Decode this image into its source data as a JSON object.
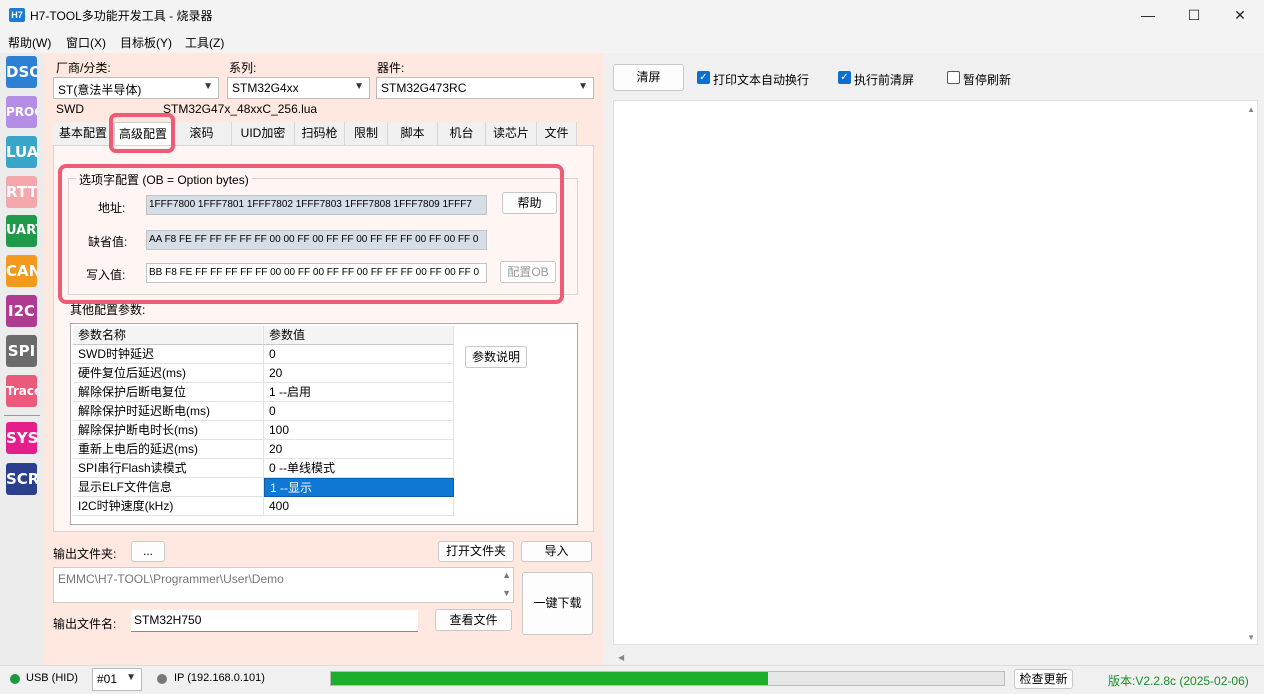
{
  "window": {
    "icon_text": "H7",
    "title": "H7-TOOL多功能开发工具 - 烧录器",
    "minimize": "—",
    "maximize": "☐",
    "close": "✕"
  },
  "menu": [
    "帮助(W)",
    "窗口(X)",
    "目标板(Y)",
    "工具(Z)"
  ],
  "toolbar": [
    {
      "label": "DSO",
      "color": "#2f7fd3"
    },
    {
      "label": "PROG",
      "color": "#b48ee6"
    },
    {
      "label": "LUA",
      "color": "#39a6c8"
    },
    {
      "label": "RTT",
      "color": "#f4a8ac"
    },
    {
      "label": "UART",
      "color": "#1f9a4a"
    },
    {
      "label": "CAN",
      "color": "#f39a1e"
    },
    {
      "label": "I2C",
      "color": "#b03a8f"
    },
    {
      "label": "SPI",
      "color": "#6b6b6b"
    },
    {
      "label": "Trace",
      "color": "#ea5a7a"
    },
    {
      "label": "SYS",
      "color": "#e41e8a"
    },
    {
      "label": "SCR",
      "color": "#2b3f8e"
    }
  ],
  "form": {
    "vendor_label": "厂商/分类:",
    "vendor_value": "ST(意法半导体)",
    "series_label": "系列:",
    "series_value": "STM32G4xx",
    "device_label": "器件:",
    "device_value": "STM32G473RC",
    "interface": "SWD",
    "lua_file": "STM32G47x_48xxC_256.lua"
  },
  "tabs": [
    "基本配置",
    "高级配置",
    "滚码",
    "UID加密",
    "扫码枪",
    "限制",
    "脚本",
    "机台",
    "读芯片",
    "文件"
  ],
  "active_tab": "高级配置",
  "option_bytes": {
    "group_title": "选项字配置 (OB = Option bytes)",
    "address_label": "地址:",
    "address_value": "1FFF7800 1FFF7801 1FFF7802 1FFF7803 1FFF7808 1FFF7809 1FFF7",
    "default_label": "缺省值:",
    "default_value": "AA F8 FE FF FF FF FF FF 00 00 FF 00 FF FF 00 FF FF FF 00 FF 00 FF 0",
    "write_label": "写入值:",
    "write_value": "BB F8 FE FF FF FF FF FF 00 00 FF 00 FF FF 00 FF FF FF 00 FF 00 FF 0",
    "help_button": "帮助",
    "config_button": "配置OB"
  },
  "params": {
    "section_title": "其他配置参数:",
    "col_name": "参数名称",
    "col_value": "参数值",
    "explain_button": "参数说明",
    "rows": [
      {
        "name": "SWD时钟延迟",
        "value": "0"
      },
      {
        "name": "硬件复位后延迟(ms)",
        "value": "20"
      },
      {
        "name": "解除保护后断电复位",
        "value": "1 --启用"
      },
      {
        "name": "解除保护时延迟断电(ms)",
        "value": "0"
      },
      {
        "name": "解除保护断电时长(ms)",
        "value": "100"
      },
      {
        "name": "重新上电后的延迟(ms)",
        "value": "20"
      },
      {
        "name": "SPI串行Flash读模式",
        "value": "0 --单线模式"
      },
      {
        "name": "显示ELF文件信息",
        "value": "1 --显示"
      },
      {
        "name": "I2C时钟速度(kHz)",
        "value": "400"
      }
    ]
  },
  "output": {
    "folder_label": "输出文件夹:",
    "browse_button": "...",
    "open_folder_button": "打开文件夹",
    "import_button": "导入",
    "path": "EMMC\\H7-TOOL\\Programmer\\User\\Demo",
    "file_label": "输出文件名:",
    "file_value": "STM32H750",
    "view_file_button": "查看文件",
    "one_click_button": "一键下载"
  },
  "right": {
    "clear_button": "清屏",
    "wrap_label": "打印文本自动换行",
    "clear_before_label": "执行前清屏",
    "pause_label": "暂停刷新"
  },
  "status": {
    "usb_label": "USB (HID)",
    "usb_color": "#1a9a3a",
    "device_no": "#01",
    "ip_label": "IP (192.168.0.101)",
    "ip_color": "#777777",
    "progress": 0.65,
    "progress_color": "#1aae2a",
    "check_update": "检查更新",
    "version": "版本:V2.2.8c (2025-02-06)"
  }
}
